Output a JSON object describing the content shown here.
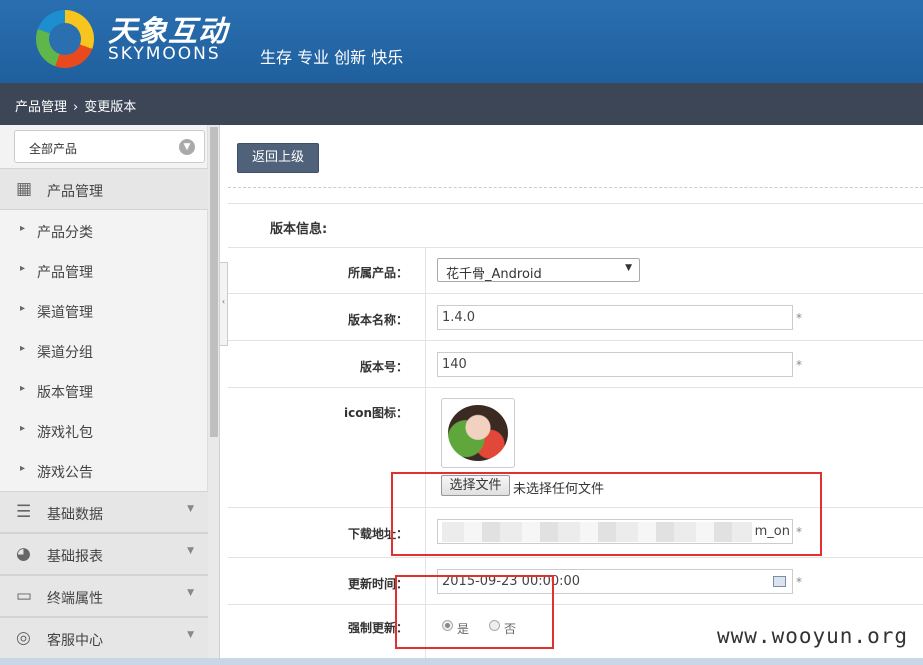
{
  "header": {
    "brand_cn": "天象互动",
    "brand_en": "SKYMOONS",
    "slogan": "生存 专业 创新 快乐"
  },
  "breadcrumb": {
    "parent": "产品管理",
    "current": "变更版本",
    "separator": "›"
  },
  "sidebar": {
    "product_filter": "全部产品",
    "product_manage": "产品管理",
    "items": [
      "产品分类",
      "产品管理",
      "渠道管理",
      "渠道分组",
      "版本管理",
      "游戏礼包",
      "游戏公告"
    ],
    "groups": [
      "基础数据",
      "基础报表",
      "终端属性",
      "客服中心"
    ]
  },
  "toolbar": {
    "back_label": "返回上级"
  },
  "form": {
    "section_title": "版本信息:",
    "product_label": "所属产品：",
    "product_value": "花千骨_Android",
    "version_name_label": "版本名称：",
    "version_name_value": "1.4.0",
    "version_code_label": "版本号：",
    "version_code_value": "140",
    "icon_label": "icon图标：",
    "file_button": "选择文件",
    "file_status": "未选择任何文件",
    "download_label": "下载地址：",
    "download_suffix": "m_on",
    "update_time_label": "更新时间：",
    "update_time_value": "2015-09-23 00:00:00",
    "force_update_label": "强制更新：",
    "force_yes": "是",
    "force_no": "否",
    "required_mark": "*"
  },
  "watermark": "www.wooyun.org"
}
